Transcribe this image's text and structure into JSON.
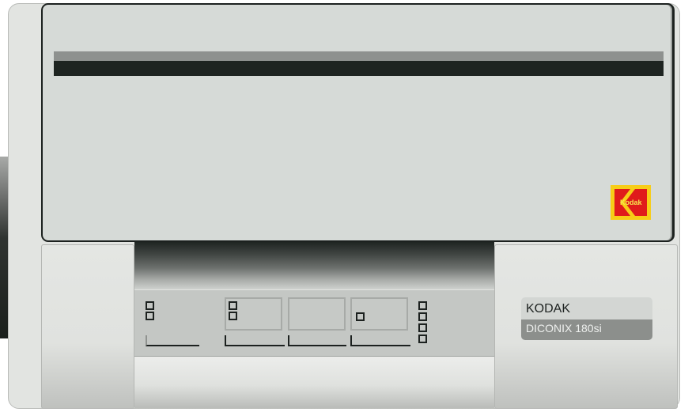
{
  "logo": {
    "text": "Kodak"
  },
  "badge": {
    "brand": "KODAK",
    "model": "DICONIX  180si"
  },
  "control_panel": {
    "led_groups": [
      {
        "name": "group-1",
        "leds": 2
      },
      {
        "name": "group-2",
        "leds": 2
      },
      {
        "name": "group-3",
        "leds": 0
      },
      {
        "name": "group-4",
        "leds": 1
      },
      {
        "name": "group-5",
        "leds": 4
      }
    ]
  },
  "colors": {
    "body": "#e2e4e1",
    "lid": "#d6dad7",
    "slot": "#1e2421",
    "logo_yellow": "#f7cd17",
    "logo_red": "#e01b1b",
    "badge_dark": "#8c8f8c"
  }
}
